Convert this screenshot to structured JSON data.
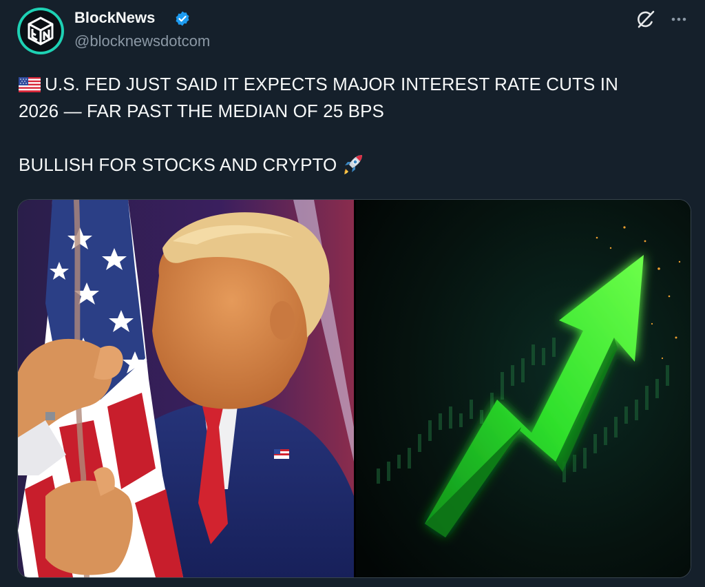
{
  "author": {
    "display_name": "BlockNews",
    "handle": "@blocknewsdotcom",
    "avatar_text": "EN",
    "verified": true
  },
  "tweet": {
    "line1": "U.S. FED JUST SAID IT EXPECTS MAJOR INTEREST RATE CUTS IN",
    "line2": "2026 — FAR PAST THE MEDIAN OF 25 BPS",
    "line3": "BULLISH FOR STOCKS AND CRYPTO",
    "leading_emoji": "us-flag-icon",
    "trailing_emoji": "rocket-icon"
  },
  "media": {
    "left_image": "man-kissing-american-flag-photo",
    "right_image": "green-arrow-upward-chart-graphic"
  },
  "icons": {
    "grok": "grok-icon",
    "more": "more-options-icon"
  },
  "colors": {
    "background": "#15202b",
    "text": "#f7f9f9",
    "secondary_text": "#8b98a5",
    "verified": "#1d9bf0",
    "avatar_accent": "#1ed1b4"
  }
}
